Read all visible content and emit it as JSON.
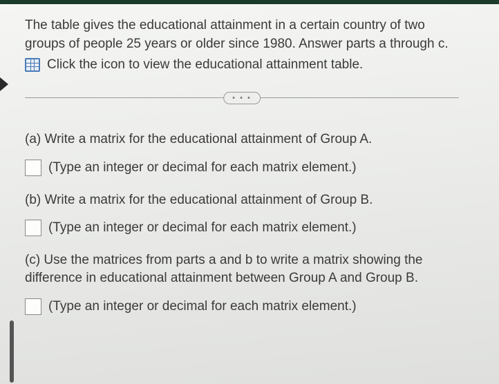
{
  "intro": "The table gives the educational attainment in a certain country of two groups of people 25 years or older since 1980. Answer parts a through c.",
  "icon_instruction": "Click the icon to view the educational attainment table.",
  "separator_label": "• • •",
  "parts": {
    "a": {
      "prompt": "(a) Write a matrix for the educational attainment of Group A.",
      "hint": "(Type an integer or decimal for each matrix element.)"
    },
    "b": {
      "prompt": "(b) Write a matrix for the educational attainment of Group B.",
      "hint": "(Type an integer or decimal for each matrix element.)"
    },
    "c": {
      "prompt": "(c) Use the matrices from parts a and b to write a matrix showing the difference in educational attainment between Group A and Group B.",
      "hint": "(Type an integer or decimal for each matrix element.)"
    }
  }
}
